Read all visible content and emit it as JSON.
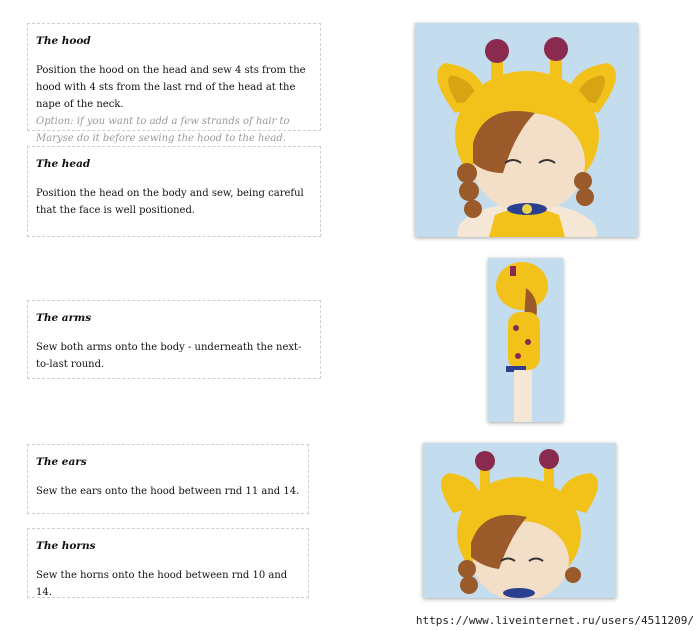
{
  "sections": {
    "hood": {
      "title": "The hood",
      "text": "Position the hood on the head and sew 4 sts from the hood with 4 sts from the last rnd of the head at the nape of the neck.",
      "note": "Option: if you want to add a few strands of hair to Maryse do it before sewing the hood to the head."
    },
    "head": {
      "title": "The head",
      "text": "Position the head on the body and sew, being careful that the face is well positioned."
    },
    "arms": {
      "title": "The arms",
      "text": "Sew both arms onto the body - underneath the next-to-last round."
    },
    "ears": {
      "title": "The ears",
      "text": "Sew the ears onto the hood between rnd 11 and 14."
    },
    "horns": {
      "title": "The horns",
      "text": "Sew the horns onto the hood between rnd 10 and 14."
    }
  },
  "watermark": "https://www.liveinternet.ru/users/4511209/",
  "colors": {
    "yarn_yellow": "#f2c21b",
    "horn_purple": "#8a2a4e",
    "hair_brown": "#9a5a2a",
    "skin": "#f3dfc8",
    "photo_bg": "#b9d6ec"
  }
}
